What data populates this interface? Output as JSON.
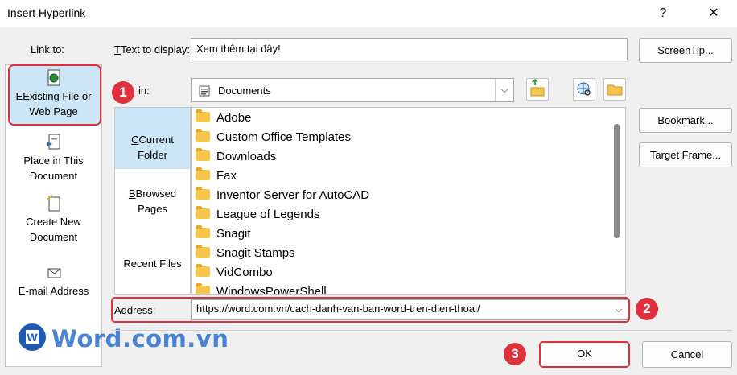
{
  "window": {
    "title": "Insert Hyperlink",
    "help": "?",
    "close": "✕"
  },
  "link_to": {
    "label": "Link to:",
    "items": [
      {
        "line1": "Existing File or",
        "line2": "Web Page"
      },
      {
        "line1": "Place in This",
        "line2": "Document"
      },
      {
        "line1": "Create New",
        "line2": "Document"
      },
      {
        "line1": "E-mail Address",
        "line2": ""
      }
    ]
  },
  "text_to_display": {
    "label": "Text to display:",
    "value": "Xem thêm tại đây!"
  },
  "look_in": {
    "label": "in:",
    "value": "Documents"
  },
  "nav": {
    "current_folder": "Current Folder",
    "browsed_pages_1": "Browsed",
    "browsed_pages_2": "Pages",
    "recent_files": "Recent Files"
  },
  "folders": [
    "Adobe",
    "Custom Office Templates",
    "Downloads",
    "Fax",
    "Inventor Server for AutoCAD",
    "League of Legends",
    "Snagit",
    "Snagit Stamps",
    "VidCombo",
    "WindowsPowerShell"
  ],
  "address": {
    "label": "Address:",
    "value": "https://word.com.vn/cach-danh-van-ban-word-tren-dien-thoai/"
  },
  "buttons": {
    "screentip": "ScreenTip...",
    "bookmark": "Bookmark...",
    "target_frame": "Target Frame...",
    "ok": "OK",
    "cancel": "Cancel"
  },
  "callouts": [
    "1",
    "2",
    "3"
  ],
  "watermark": "Word.com.vn",
  "colors": {
    "accent_red": "#e0303c",
    "selection": "#cde6f7",
    "folder": "#f6c64a"
  }
}
